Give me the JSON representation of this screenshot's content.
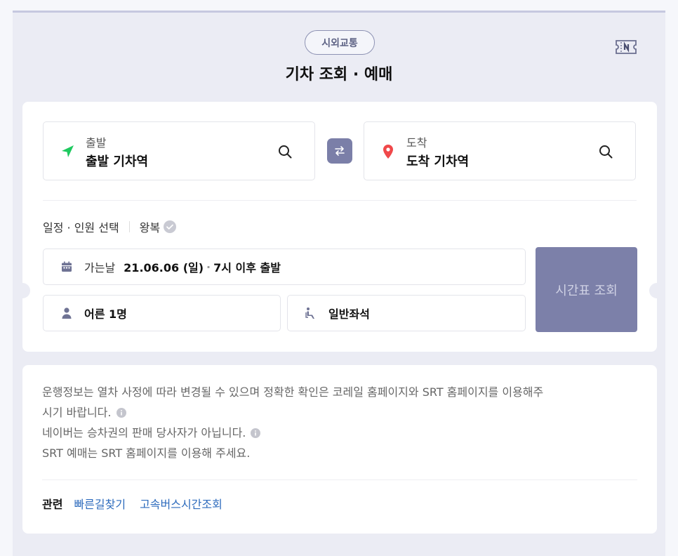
{
  "header": {
    "tag_label": "시외교통",
    "title": "기차 조회 · 예매",
    "ticket_icon": "ticket-n-icon"
  },
  "route": {
    "departure": {
      "label": "출발",
      "value": "출발 기차역",
      "icon": "navigation-arrow-icon",
      "icon_color": "#1ec95f"
    },
    "arrival": {
      "label": "도착",
      "value": "도착 기차역",
      "icon": "map-pin-icon",
      "icon_color": "#f0484a"
    },
    "swap_icon": "swap-arrows-icon"
  },
  "options": {
    "schedule_label": "일정 · 인원 선택",
    "roundtrip_label": "왕복"
  },
  "date": {
    "label": "가는날",
    "value": "21.06.06 (일)",
    "separator": "·",
    "time": "7시 이후 출발"
  },
  "passengers": {
    "value": "어른 1명"
  },
  "seat": {
    "value": "일반좌석"
  },
  "submit_label": "시간표 조회",
  "info": {
    "line1a": "운행정보는 열차 사정에 따라 변경될 수 있으며 정확한 확인은 코레일 홈페이지와 SRT 홈페이지를 이용해주",
    "line1b": "시기 바랍니다.",
    "line2": "네이버는 승차권의 판매 당사자가 아닙니다.",
    "line3": "SRT 예매는 SRT 홈페이지를 이용해 주세요."
  },
  "related": {
    "title": "관련",
    "links": [
      "빠른길찾기",
      "고속버스시간조회"
    ]
  },
  "colors": {
    "accent": "#7b7fa8",
    "link": "#2d6bbd",
    "background": "#ebecf4"
  }
}
